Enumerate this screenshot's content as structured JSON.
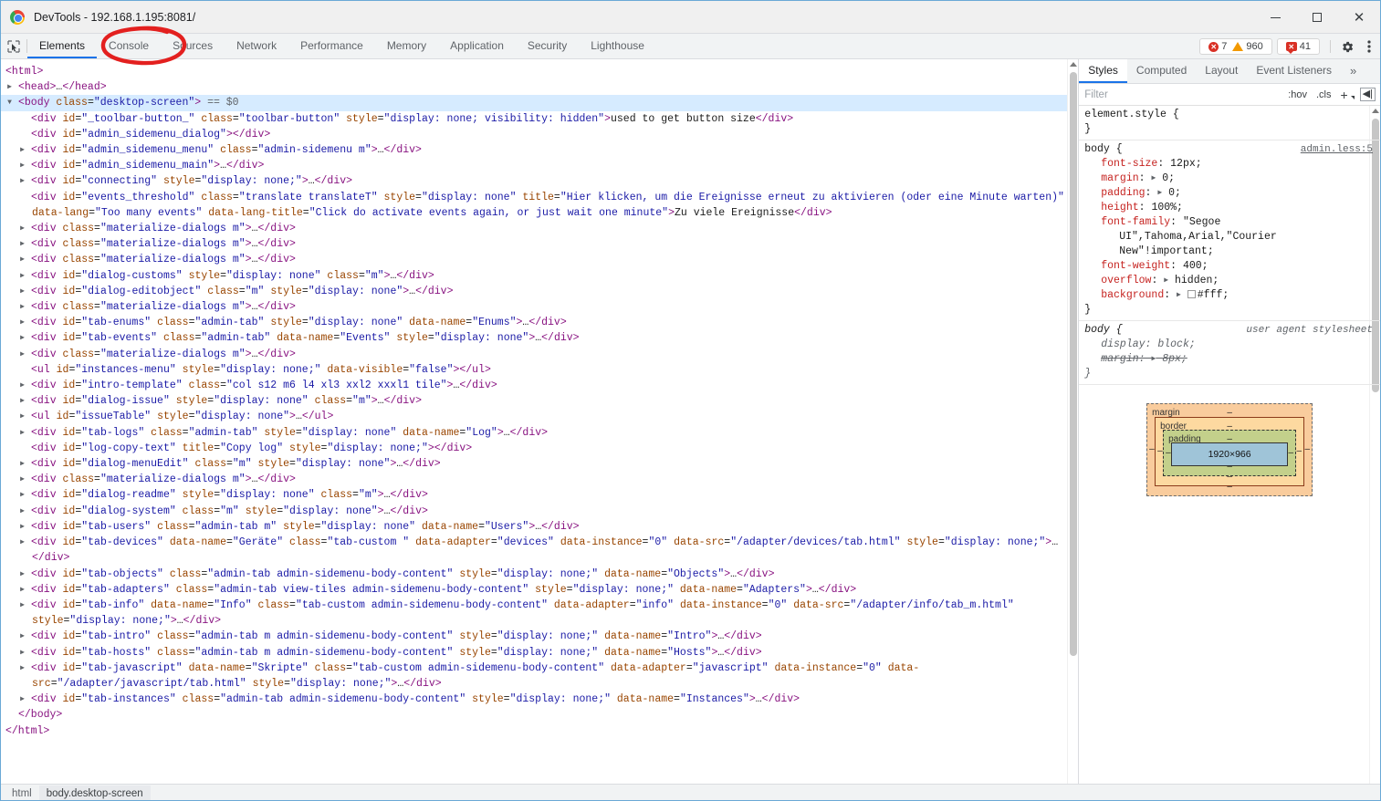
{
  "window": {
    "title": "DevTools - 192.168.1.195:8081/",
    "logo_icon": "chrome-logo",
    "minimize_label": "–",
    "maximize_label": "□",
    "close_label": "✕"
  },
  "devtools_tabs": {
    "inspect_icon": "inspect-element-icon",
    "items": [
      {
        "label": "Elements",
        "active": true
      },
      {
        "label": "Console",
        "active": false
      },
      {
        "label": "Sources",
        "active": false
      },
      {
        "label": "Network",
        "active": false
      },
      {
        "label": "Performance",
        "active": false
      },
      {
        "label": "Memory",
        "active": false
      },
      {
        "label": "Application",
        "active": false
      },
      {
        "label": "Security",
        "active": false
      },
      {
        "label": "Lighthouse",
        "active": false
      }
    ],
    "counters": {
      "errors": "7",
      "warnings": "960",
      "issues": "41",
      "error_glyph": "✕",
      "issue_glyph": "✕"
    },
    "settings_icon": "gear-icon",
    "more_icon": "kebab-menu-icon"
  },
  "annotation": {
    "shape": "hand-drawn-ellipse",
    "color": "#e3201f",
    "targets": "Console"
  },
  "dom_tree": {
    "lines": [
      {
        "indent": 0,
        "arrow": "",
        "html": "<span class=\"tg\">&lt;html&gt;</span>"
      },
      {
        "indent": 1,
        "arrow": "▶",
        "html": "<span class=\"tg\">&lt;head&gt;</span><span class=\"tx\">…</span><span class=\"tg\">&lt;/head&gt;</span>"
      },
      {
        "indent": 1,
        "arrow": "▼",
        "selected": true,
        "dots": "⋯",
        "html": "<span class=\"tg\">&lt;body</span> <span class=\"at\">class</span>=<span class=\"av\">\"desktop-screen\"</span><span class=\"tg\">&gt;</span> <span class=\"sel-var\">== $0</span>"
      },
      {
        "indent": 2,
        "arrow": "",
        "html": "<span class=\"tg\">&lt;div</span> <span class=\"at\">id</span>=<span class=\"av\">\"_toolbar-button_\"</span> <span class=\"at\">class</span>=<span class=\"av\">\"toolbar-button\"</span> <span class=\"at\">style</span>=<span class=\"av\">\"display: none; visibility: hidden\"</span><span class=\"tg\">&gt;</span>used to get button size<span class=\"tg\">&lt;/div&gt;</span>"
      },
      {
        "indent": 2,
        "arrow": "",
        "html": "<span class=\"tg\">&lt;div</span> <span class=\"at\">id</span>=<span class=\"av\">\"admin_sidemenu_dialog\"</span><span class=\"tg\">&gt;&lt;/div&gt;</span>"
      },
      {
        "indent": 2,
        "arrow": "▶",
        "html": "<span class=\"tg\">&lt;div</span> <span class=\"at\">id</span>=<span class=\"av\">\"admin_sidemenu_menu\"</span> <span class=\"at\">class</span>=<span class=\"av\">\"admin-sidemenu m\"</span><span class=\"tg\">&gt;</span><span class=\"tx\">…</span><span class=\"tg\">&lt;/div&gt;</span>"
      },
      {
        "indent": 2,
        "arrow": "▶",
        "html": "<span class=\"tg\">&lt;div</span> <span class=\"at\">id</span>=<span class=\"av\">\"admin_sidemenu_main\"</span><span class=\"tg\">&gt;</span><span class=\"tx\">…</span><span class=\"tg\">&lt;/div&gt;</span>"
      },
      {
        "indent": 2,
        "arrow": "▶",
        "html": "<span class=\"tg\">&lt;div</span> <span class=\"at\">id</span>=<span class=\"av\">\"connecting\"</span> <span class=\"at\">style</span>=<span class=\"av\">\"display: none;\"</span><span class=\"tg\">&gt;</span><span class=\"tx\">…</span><span class=\"tg\">&lt;/div&gt;</span>"
      },
      {
        "indent": 2,
        "arrow": "",
        "html": "<span class=\"tg\">&lt;div</span> <span class=\"at\">id</span>=<span class=\"av\">\"events_threshold\"</span> <span class=\"at\">class</span>=<span class=\"av\">\"translate translateT\"</span> <span class=\"at\">style</span>=<span class=\"av\">\"display: none\"</span> <span class=\"at\">title</span>=<span class=\"av\">\"Hier klicken, um die Ereignisse erneut zu aktivieren (oder eine Minute warten)\"</span> <span class=\"at\">data-lang</span>=<span class=\"av\">\"Too many events\"</span> <span class=\"at\">data-lang-title</span>=<span class=\"av\">\"Click do activate events again, or just wait one minute\"</span><span class=\"tg\">&gt;</span>Zu viele Ereignisse<span class=\"tg\">&lt;/div&gt;</span>"
      },
      {
        "indent": 2,
        "arrow": "▶",
        "html": "<span class=\"tg\">&lt;div</span> <span class=\"at\">class</span>=<span class=\"av\">\"materialize-dialogs m\"</span><span class=\"tg\">&gt;</span><span class=\"tx\">…</span><span class=\"tg\">&lt;/div&gt;</span>"
      },
      {
        "indent": 2,
        "arrow": "▶",
        "html": "<span class=\"tg\">&lt;div</span> <span class=\"at\">class</span>=<span class=\"av\">\"materialize-dialogs m\"</span><span class=\"tg\">&gt;</span><span class=\"tx\">…</span><span class=\"tg\">&lt;/div&gt;</span>"
      },
      {
        "indent": 2,
        "arrow": "▶",
        "html": "<span class=\"tg\">&lt;div</span> <span class=\"at\">class</span>=<span class=\"av\">\"materialize-dialogs m\"</span><span class=\"tg\">&gt;</span><span class=\"tx\">…</span><span class=\"tg\">&lt;/div&gt;</span>"
      },
      {
        "indent": 2,
        "arrow": "▶",
        "html": "<span class=\"tg\">&lt;div</span> <span class=\"at\">id</span>=<span class=\"av\">\"dialog-customs\"</span> <span class=\"at\">style</span>=<span class=\"av\">\"display: none\"</span> <span class=\"at\">class</span>=<span class=\"av\">\"m\"</span><span class=\"tg\">&gt;</span><span class=\"tx\">…</span><span class=\"tg\">&lt;/div&gt;</span>"
      },
      {
        "indent": 2,
        "arrow": "▶",
        "html": "<span class=\"tg\">&lt;div</span> <span class=\"at\">id</span>=<span class=\"av\">\"dialog-editobject\"</span> <span class=\"at\">class</span>=<span class=\"av\">\"m\"</span> <span class=\"at\">style</span>=<span class=\"av\">\"display: none\"</span><span class=\"tg\">&gt;</span><span class=\"tx\">…</span><span class=\"tg\">&lt;/div&gt;</span>"
      },
      {
        "indent": 2,
        "arrow": "▶",
        "html": "<span class=\"tg\">&lt;div</span> <span class=\"at\">class</span>=<span class=\"av\">\"materialize-dialogs m\"</span><span class=\"tg\">&gt;</span><span class=\"tx\">…</span><span class=\"tg\">&lt;/div&gt;</span>"
      },
      {
        "indent": 2,
        "arrow": "▶",
        "html": "<span class=\"tg\">&lt;div</span> <span class=\"at\">id</span>=<span class=\"av\">\"tab-enums\"</span> <span class=\"at\">class</span>=<span class=\"av\">\"admin-tab\"</span> <span class=\"at\">style</span>=<span class=\"av\">\"display: none\"</span> <span class=\"at\">data-name</span>=<span class=\"av\">\"Enums\"</span><span class=\"tg\">&gt;</span><span class=\"tx\">…</span><span class=\"tg\">&lt;/div&gt;</span>"
      },
      {
        "indent": 2,
        "arrow": "▶",
        "html": "<span class=\"tg\">&lt;div</span> <span class=\"at\">id</span>=<span class=\"av\">\"tab-events\"</span> <span class=\"at\">class</span>=<span class=\"av\">\"admin-tab\"</span> <span class=\"at\">data-name</span>=<span class=\"av\">\"Events\"</span> <span class=\"at\">style</span>=<span class=\"av\">\"display: none\"</span><span class=\"tg\">&gt;</span><span class=\"tx\">…</span><span class=\"tg\">&lt;/div&gt;</span>"
      },
      {
        "indent": 2,
        "arrow": "▶",
        "html": "<span class=\"tg\">&lt;div</span> <span class=\"at\">class</span>=<span class=\"av\">\"materialize-dialogs m\"</span><span class=\"tg\">&gt;</span><span class=\"tx\">…</span><span class=\"tg\">&lt;/div&gt;</span>"
      },
      {
        "indent": 2,
        "arrow": "",
        "html": "<span class=\"tg\">&lt;ul</span> <span class=\"at\">id</span>=<span class=\"av\">\"instances-menu\"</span> <span class=\"at\">style</span>=<span class=\"av\">\"display: none;\"</span> <span class=\"at\">data-visible</span>=<span class=\"av\">\"false\"</span><span class=\"tg\">&gt;&lt;/ul&gt;</span>"
      },
      {
        "indent": 2,
        "arrow": "▶",
        "html": "<span class=\"tg\">&lt;div</span> <span class=\"at\">id</span>=<span class=\"av\">\"intro-template\"</span> <span class=\"at\">class</span>=<span class=\"av\">\"col s12 m6 l4 xl3 xxl2 xxxl1 tile\"</span><span class=\"tg\">&gt;</span><span class=\"tx\">…</span><span class=\"tg\">&lt;/div&gt;</span>"
      },
      {
        "indent": 2,
        "arrow": "▶",
        "html": "<span class=\"tg\">&lt;div</span> <span class=\"at\">id</span>=<span class=\"av\">\"dialog-issue\"</span> <span class=\"at\">style</span>=<span class=\"av\">\"display: none\"</span> <span class=\"at\">class</span>=<span class=\"av\">\"m\"</span><span class=\"tg\">&gt;</span><span class=\"tx\">…</span><span class=\"tg\">&lt;/div&gt;</span>"
      },
      {
        "indent": 2,
        "arrow": "▶",
        "html": "<span class=\"tg\">&lt;ul</span> <span class=\"at\">id</span>=<span class=\"av\">\"issueTable\"</span> <span class=\"at\">style</span>=<span class=\"av\">\"display: none\"</span><span class=\"tg\">&gt;</span><span class=\"tx\">…</span><span class=\"tg\">&lt;/ul&gt;</span>"
      },
      {
        "indent": 2,
        "arrow": "▶",
        "html": "<span class=\"tg\">&lt;div</span> <span class=\"at\">id</span>=<span class=\"av\">\"tab-logs\"</span> <span class=\"at\">class</span>=<span class=\"av\">\"admin-tab\"</span> <span class=\"at\">style</span>=<span class=\"av\">\"display: none\"</span> <span class=\"at\">data-name</span>=<span class=\"av\">\"Log\"</span><span class=\"tg\">&gt;</span><span class=\"tx\">…</span><span class=\"tg\">&lt;/div&gt;</span>"
      },
      {
        "indent": 2,
        "arrow": "",
        "html": "<span class=\"tg\">&lt;div</span> <span class=\"at\">id</span>=<span class=\"av\">\"log-copy-text\"</span> <span class=\"at\">title</span>=<span class=\"av\">\"Copy log\"</span> <span class=\"at\">style</span>=<span class=\"av\">\"display: none;\"</span><span class=\"tg\">&gt;&lt;/div&gt;</span>"
      },
      {
        "indent": 2,
        "arrow": "▶",
        "html": "<span class=\"tg\">&lt;div</span> <span class=\"at\">id</span>=<span class=\"av\">\"dialog-menuEdit\"</span> <span class=\"at\">class</span>=<span class=\"av\">\"m\"</span> <span class=\"at\">style</span>=<span class=\"av\">\"display: none\"</span><span class=\"tg\">&gt;</span><span class=\"tx\">…</span><span class=\"tg\">&lt;/div&gt;</span>"
      },
      {
        "indent": 2,
        "arrow": "▶",
        "html": "<span class=\"tg\">&lt;div</span> <span class=\"at\">class</span>=<span class=\"av\">\"materialize-dialogs m\"</span><span class=\"tg\">&gt;</span><span class=\"tx\">…</span><span class=\"tg\">&lt;/div&gt;</span>"
      },
      {
        "indent": 2,
        "arrow": "▶",
        "html": "<span class=\"tg\">&lt;div</span> <span class=\"at\">id</span>=<span class=\"av\">\"dialog-readme\"</span> <span class=\"at\">style</span>=<span class=\"av\">\"display: none\"</span> <span class=\"at\">class</span>=<span class=\"av\">\"m\"</span><span class=\"tg\">&gt;</span><span class=\"tx\">…</span><span class=\"tg\">&lt;/div&gt;</span>"
      },
      {
        "indent": 2,
        "arrow": "▶",
        "html": "<span class=\"tg\">&lt;div</span> <span class=\"at\">id</span>=<span class=\"av\">\"dialog-system\"</span> <span class=\"at\">class</span>=<span class=\"av\">\"m\"</span> <span class=\"at\">style</span>=<span class=\"av\">\"display: none\"</span><span class=\"tg\">&gt;</span><span class=\"tx\">…</span><span class=\"tg\">&lt;/div&gt;</span>"
      },
      {
        "indent": 2,
        "arrow": "▶",
        "html": "<span class=\"tg\">&lt;div</span> <span class=\"at\">id</span>=<span class=\"av\">\"tab-users\"</span> <span class=\"at\">class</span>=<span class=\"av\">\"admin-tab m\"</span> <span class=\"at\">style</span>=<span class=\"av\">\"display: none\"</span> <span class=\"at\">data-name</span>=<span class=\"av\">\"Users\"</span><span class=\"tg\">&gt;</span><span class=\"tx\">…</span><span class=\"tg\">&lt;/div&gt;</span>"
      },
      {
        "indent": 2,
        "arrow": "▶",
        "html": "<span class=\"tg\">&lt;div</span> <span class=\"at\">id</span>=<span class=\"av\">\"tab-devices\"</span> <span class=\"at\">data-name</span>=<span class=\"av\">\"Geräte\"</span> <span class=\"at\">class</span>=<span class=\"av\">\"tab-custom \"</span> <span class=\"at\">data-adapter</span>=<span class=\"av\">\"devices\"</span> <span class=\"at\">data-instance</span>=<span class=\"av\">\"0\"</span> <span class=\"at\">data-src</span>=<span class=\"av\">\"/adapter/devices/tab.html\"</span> <span class=\"at\">style</span>=<span class=\"av\">\"display: none;\"</span><span class=\"tg\">&gt;</span><span class=\"tx\">…</span><span class=\"tg\">&lt;/div&gt;</span>"
      },
      {
        "indent": 2,
        "arrow": "▶",
        "html": "<span class=\"tg\">&lt;div</span> <span class=\"at\">id</span>=<span class=\"av\">\"tab-objects\"</span> <span class=\"at\">class</span>=<span class=\"av\">\"admin-tab admin-sidemenu-body-content\"</span> <span class=\"at\">style</span>=<span class=\"av\">\"display: none;\"</span> <span class=\"at\">data-name</span>=<span class=\"av\">\"Objects\"</span><span class=\"tg\">&gt;</span><span class=\"tx\">…</span><span class=\"tg\">&lt;/div&gt;</span>"
      },
      {
        "indent": 2,
        "arrow": "▶",
        "html": "<span class=\"tg\">&lt;div</span> <span class=\"at\">id</span>=<span class=\"av\">\"tab-adapters\"</span> <span class=\"at\">class</span>=<span class=\"av\">\"admin-tab view-tiles admin-sidemenu-body-content\"</span> <span class=\"at\">style</span>=<span class=\"av\">\"display: none;\"</span> <span class=\"at\">data-name</span>=<span class=\"av\">\"Adapters\"</span><span class=\"tg\">&gt;</span><span class=\"tx\">…</span><span class=\"tg\">&lt;/div&gt;</span>"
      },
      {
        "indent": 2,
        "arrow": "▶",
        "html": "<span class=\"tg\">&lt;div</span> <span class=\"at\">id</span>=<span class=\"av\">\"tab-info\"</span> <span class=\"at\">data-name</span>=<span class=\"av\">\"Info\"</span> <span class=\"at\">class</span>=<span class=\"av\">\"tab-custom admin-sidemenu-body-content\"</span> <span class=\"at\">data-adapter</span>=<span class=\"av\">\"info\"</span> <span class=\"at\">data-instance</span>=<span class=\"av\">\"0\"</span> <span class=\"at\">data-src</span>=<span class=\"av\">\"/adapter/info/tab_m.html\"</span> <span class=\"at\">style</span>=<span class=\"av\">\"display: none;\"</span><span class=\"tg\">&gt;</span><span class=\"tx\">…</span><span class=\"tg\">&lt;/div&gt;</span>"
      },
      {
        "indent": 2,
        "arrow": "▶",
        "html": "<span class=\"tg\">&lt;div</span> <span class=\"at\">id</span>=<span class=\"av\">\"tab-intro\"</span> <span class=\"at\">class</span>=<span class=\"av\">\"admin-tab m admin-sidemenu-body-content\"</span> <span class=\"at\">style</span>=<span class=\"av\">\"display: none;\"</span> <span class=\"at\">data-name</span>=<span class=\"av\">\"Intro\"</span><span class=\"tg\">&gt;</span><span class=\"tx\">…</span><span class=\"tg\">&lt;/div&gt;</span>"
      },
      {
        "indent": 2,
        "arrow": "▶",
        "html": "<span class=\"tg\">&lt;div</span> <span class=\"at\">id</span>=<span class=\"av\">\"tab-hosts\"</span> <span class=\"at\">class</span>=<span class=\"av\">\"admin-tab m admin-sidemenu-body-content\"</span> <span class=\"at\">style</span>=<span class=\"av\">\"display: none;\"</span> <span class=\"at\">data-name</span>=<span class=\"av\">\"Hosts\"</span><span class=\"tg\">&gt;</span><span class=\"tx\">…</span><span class=\"tg\">&lt;/div&gt;</span>"
      },
      {
        "indent": 2,
        "arrow": "▶",
        "html": "<span class=\"tg\">&lt;div</span> <span class=\"at\">id</span>=<span class=\"av\">\"tab-javascript\"</span> <span class=\"at\">data-name</span>=<span class=\"av\">\"Skripte\"</span> <span class=\"at\">class</span>=<span class=\"av\">\"tab-custom admin-sidemenu-body-content\"</span> <span class=\"at\">data-adapter</span>=<span class=\"av\">\"javascript\"</span> <span class=\"at\">data-instance</span>=<span class=\"av\">\"0\"</span> <span class=\"at\">data-src</span>=<span class=\"av\">\"/adapter/javascript/tab.html\"</span> <span class=\"at\">style</span>=<span class=\"av\">\"display: none;\"</span><span class=\"tg\">&gt;</span><span class=\"tx\">…</span><span class=\"tg\">&lt;/div&gt;</span>"
      },
      {
        "indent": 2,
        "arrow": "▶",
        "html": "<span class=\"tg\">&lt;div</span> <span class=\"at\">id</span>=<span class=\"av\">\"tab-instances\"</span> <span class=\"at\">class</span>=<span class=\"av\">\"admin-tab admin-sidemenu-body-content\"</span> <span class=\"at\">style</span>=<span class=\"av\">\"display: none;\"</span> <span class=\"at\">data-name</span>=<span class=\"av\">\"Instances\"</span><span class=\"tg\">&gt;</span><span class=\"tx\">…</span><span class=\"tg\">&lt;/div&gt;</span>"
      },
      {
        "indent": 1,
        "arrow": "",
        "html": "<span class=\"tg\">&lt;/body&gt;</span>"
      },
      {
        "indent": 0,
        "arrow": "",
        "html": "<span class=\"tg\">&lt;/html&gt;</span>"
      }
    ]
  },
  "styles_panel": {
    "tabs": [
      {
        "label": "Styles",
        "active": true
      },
      {
        "label": "Computed",
        "active": false
      },
      {
        "label": "Layout",
        "active": false
      },
      {
        "label": "Event Listeners",
        "active": false
      },
      {
        "label": "»",
        "active": false
      }
    ],
    "filter": {
      "placeholder": "Filter",
      "value": ""
    },
    "buttons": {
      "hov": ":hov",
      "cls": ".cls",
      "plus": "+",
      "panel_toggle": "◀|"
    },
    "rules": [
      {
        "selector": "element.style {",
        "source": "",
        "declarations": [],
        "close": "}"
      },
      {
        "selector": "body {",
        "source": "admin.less:5",
        "declarations": [
          {
            "name": "font-size",
            "value": "12px;"
          },
          {
            "name": "margin",
            "value": "0;",
            "expandable": true
          },
          {
            "name": "padding",
            "value": "0;",
            "expandable": true
          },
          {
            "name": "height",
            "value": "100%;"
          },
          {
            "name": "font-family",
            "value": "\"Segoe UI\",Tahoma,Arial,\"Courier New\"!important;",
            "wrap": [
              "\"Segoe",
              "UI\",Tahoma,Arial,\"Courier",
              "New\"!important;"
            ]
          },
          {
            "name": "font-weight",
            "value": "400;"
          },
          {
            "name": "overflow",
            "value": "hidden;",
            "expandable": true
          },
          {
            "name": "background",
            "value": "#fff;",
            "expandable": true,
            "swatch": "#ffffff"
          }
        ],
        "close": "}"
      },
      {
        "selector": "body {",
        "source": "user agent stylesheet",
        "ua": true,
        "declarations": [
          {
            "name": "display",
            "value": "block;"
          },
          {
            "name": "margin",
            "value": "8px;",
            "expandable": true,
            "struck": true
          }
        ],
        "close": "}"
      }
    ],
    "box_model": {
      "margin_label": "margin",
      "border_label": "border",
      "padding_label": "padding",
      "content_size": "1920×966",
      "dash": "–"
    }
  },
  "breadcrumb": {
    "items": [
      {
        "label": "html",
        "active": false
      },
      {
        "label": "body.desktop-screen",
        "active": true
      }
    ]
  }
}
